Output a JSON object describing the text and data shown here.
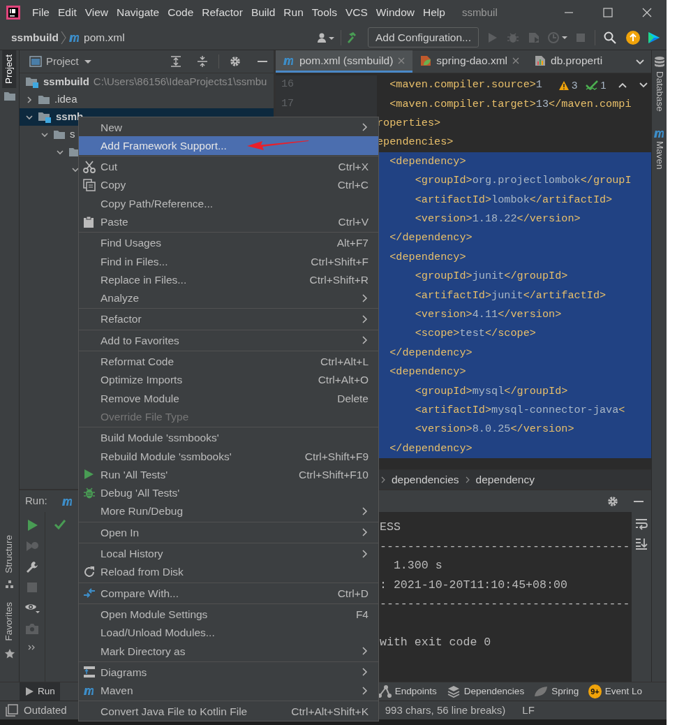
{
  "title_bar": {
    "menu": [
      "File",
      "Edit",
      "View",
      "Navigate",
      "Code",
      "Refactor",
      "Build",
      "Run",
      "Tools",
      "VCS",
      "Window",
      "Help"
    ],
    "title": "ssmbuil"
  },
  "nav_bar": {
    "breadcrumb": [
      "ssmbuild",
      "pom.xml"
    ],
    "run_config": "Add Configuration..."
  },
  "left_stripe": [
    {
      "label": "Project",
      "selected": true
    },
    {
      "label": "Structure",
      "selected": false
    },
    {
      "label": "Favorites",
      "selected": false
    }
  ],
  "right_stripe": [
    {
      "label": "Database",
      "selected": false
    },
    {
      "label": "Maven",
      "selected": false
    }
  ],
  "project_panel": {
    "title": "Project",
    "tree": [
      {
        "name": "ssmbuild",
        "path": "C:\\Users\\86156\\IdeaProjects1\\ssmbu",
        "selected": false,
        "children": [
          {
            "name": ".idea",
            "expanded": false,
            "selected": false
          },
          {
            "name": "ssmb",
            "expanded": true,
            "selected": true,
            "children": [
              {
                "name": "s",
                "expanded": true,
                "selected": false,
                "children": [
                  {
                    "expanded": true,
                    "selected": false,
                    "children": [
                      {
                        "expanded": true,
                        "selected": false
                      }
                    ]
                  }
                ]
              }
            ]
          }
        ]
      }
    ]
  },
  "editor": {
    "tabs": [
      {
        "label": "pom.xml (ssmbuild)",
        "selected": true,
        "closable": true
      },
      {
        "label": "spring-dao.xml",
        "selected": false,
        "closable": true
      },
      {
        "label": "db.properti",
        "selected": false,
        "closable": false
      }
    ],
    "inspections": {
      "warnings": "3",
      "weak_warnings": "1"
    },
    "lines": [
      {
        "number": "16",
        "text": "  <maven.compiler.source>1",
        "selected": false
      },
      {
        "number": "17",
        "text": "  <maven.compiler.target>13</maven.compi",
        "selected": false
      },
      {
        "text": "roperties>",
        "selected": false
      },
      {
        "text": "ependencies>",
        "selected": false
      },
      {
        "text": "  <dependency>",
        "selected": true
      },
      {
        "text": "      <groupId>org.projectlombok</groupI",
        "selected": true
      },
      {
        "text": "      <artifactId>lombok</artifactId>",
        "selected": true
      },
      {
        "text": "      <version>1.18.22</version>",
        "selected": true
      },
      {
        "text": "  </dependency>",
        "selected": true
      },
      {
        "text": "  <dependency>",
        "selected": true
      },
      {
        "text": "      <groupId>junit</groupId>",
        "selected": true
      },
      {
        "text": "      <artifactId>junit</artifactId>",
        "selected": true
      },
      {
        "text": "      <version>4.11</version>",
        "selected": true
      },
      {
        "text": "      <scope>test</scope>",
        "selected": true
      },
      {
        "text": "  </dependency>",
        "selected": true
      },
      {
        "text": "  <dependency>",
        "selected": true
      },
      {
        "text": "      <groupId>mysql</groupId>",
        "selected": true
      },
      {
        "text": "      <artifactId>mysql-connector-java<",
        "selected": true
      },
      {
        "text": "      <version>8.0.25</version>",
        "selected": true
      },
      {
        "text": "  </dependency>",
        "selected": true
      }
    ],
    "breadcrumb": [
      "dependencies",
      "dependency"
    ]
  },
  "run_window": {
    "label": "Run:",
    "console": [
      "ESS",
      "------------------------------------",
      "  1.300 s",
      ": 2021-10-20T11:10:45+08:00",
      "------------------------------------",
      "with exit code 0"
    ]
  },
  "bottom_tabs": [
    {
      "label": "Run",
      "selected": true
    },
    {
      "label": "Endpoints",
      "selected": false
    },
    {
      "label": "Dependencies",
      "selected": false
    },
    {
      "label": "Spring",
      "selected": false
    },
    {
      "label": "Event Lo",
      "badge": "9+",
      "selected": false
    }
  ],
  "status_bar": {
    "message": "Outdated",
    "file_info": "993 chars, 56 line breaks)",
    "line_separator": "LF"
  },
  "context_menu": [
    {
      "kind": "item",
      "label": "New",
      "submenu": true,
      "selected": false,
      "disabled": false
    },
    {
      "kind": "item",
      "label": "Add Framework Support...",
      "submenu": false,
      "selected": true,
      "disabled": false
    },
    {
      "kind": "separator"
    },
    {
      "kind": "item",
      "label": "Cut",
      "shortcut": "Ctrl+X",
      "submenu": false,
      "selected": false,
      "disabled": false
    },
    {
      "kind": "item",
      "label": "Copy",
      "shortcut": "Ctrl+C",
      "submenu": false,
      "selected": false,
      "disabled": false
    },
    {
      "kind": "item",
      "label": "Copy Path/Reference...",
      "submenu": false,
      "selected": false,
      "disabled": false
    },
    {
      "kind": "item",
      "label": "Paste",
      "shortcut": "Ctrl+V",
      "submenu": false,
      "selected": false,
      "disabled": false
    },
    {
      "kind": "separator"
    },
    {
      "kind": "item",
      "label": "Find Usages",
      "shortcut": "Alt+F7",
      "submenu": false,
      "selected": false,
      "disabled": false
    },
    {
      "kind": "item",
      "label": "Find in Files...",
      "shortcut": "Ctrl+Shift+F",
      "submenu": false,
      "selected": false,
      "disabled": false
    },
    {
      "kind": "item",
      "label": "Replace in Files...",
      "shortcut": "Ctrl+Shift+R",
      "submenu": false,
      "selected": false,
      "disabled": false
    },
    {
      "kind": "item",
      "label": "Analyze",
      "submenu": true,
      "selected": false,
      "disabled": false
    },
    {
      "kind": "separator"
    },
    {
      "kind": "item",
      "label": "Refactor",
      "submenu": true,
      "selected": false,
      "disabled": false
    },
    {
      "kind": "separator"
    },
    {
      "kind": "item",
      "label": "Add to Favorites",
      "submenu": true,
      "selected": false,
      "disabled": false
    },
    {
      "kind": "separator"
    },
    {
      "kind": "item",
      "label": "Reformat Code",
      "shortcut": "Ctrl+Alt+L",
      "submenu": false,
      "selected": false,
      "disabled": false
    },
    {
      "kind": "item",
      "label": "Optimize Imports",
      "shortcut": "Ctrl+Alt+O",
      "submenu": false,
      "selected": false,
      "disabled": false
    },
    {
      "kind": "item",
      "label": "Remove Module",
      "shortcut": "Delete",
      "submenu": false,
      "selected": false,
      "disabled": false
    },
    {
      "kind": "item",
      "label": "Override File Type",
      "submenu": false,
      "selected": false,
      "disabled": true
    },
    {
      "kind": "separator"
    },
    {
      "kind": "item",
      "label": "Build Module 'ssmbooks'",
      "submenu": false,
      "selected": false,
      "disabled": false
    },
    {
      "kind": "item",
      "label": "Rebuild Module 'ssmbooks'",
      "shortcut": "Ctrl+Shift+F9",
      "submenu": false,
      "selected": false,
      "disabled": false
    },
    {
      "kind": "item",
      "label": "Run 'All Tests'",
      "shortcut": "Ctrl+Shift+F10",
      "submenu": false,
      "selected": false,
      "disabled": false
    },
    {
      "kind": "item",
      "label": "Debug 'All Tests'",
      "submenu": false,
      "selected": false,
      "disabled": false
    },
    {
      "kind": "item",
      "label": "More Run/Debug",
      "submenu": true,
      "selected": false,
      "disabled": false
    },
    {
      "kind": "separator"
    },
    {
      "kind": "item",
      "label": "Open In",
      "submenu": true,
      "selected": false,
      "disabled": false
    },
    {
      "kind": "separator"
    },
    {
      "kind": "item",
      "label": "Local History",
      "submenu": true,
      "selected": false,
      "disabled": false
    },
    {
      "kind": "item",
      "label": "Reload from Disk",
      "submenu": false,
      "selected": false,
      "disabled": false
    },
    {
      "kind": "separator"
    },
    {
      "kind": "item",
      "label": "Compare With...",
      "shortcut": "Ctrl+D",
      "submenu": false,
      "selected": false,
      "disabled": false
    },
    {
      "kind": "separator"
    },
    {
      "kind": "item",
      "label": "Open Module Settings",
      "shortcut": "F4",
      "submenu": false,
      "selected": false,
      "disabled": false
    },
    {
      "kind": "item",
      "label": "Load/Unload Modules...",
      "submenu": false,
      "selected": false,
      "disabled": false
    },
    {
      "kind": "item",
      "label": "Mark Directory as",
      "submenu": true,
      "selected": false,
      "disabled": false
    },
    {
      "kind": "separator"
    },
    {
      "kind": "item",
      "label": "Diagrams",
      "submenu": true,
      "selected": false,
      "disabled": false
    },
    {
      "kind": "item",
      "label": "Maven",
      "submenu": true,
      "selected": false,
      "disabled": false
    },
    {
      "kind": "separator"
    },
    {
      "kind": "item",
      "label": "Convert Java File to Kotlin File",
      "shortcut": "Ctrl+Alt+Shift+K",
      "submenu": false,
      "selected": false,
      "disabled": false
    }
  ]
}
